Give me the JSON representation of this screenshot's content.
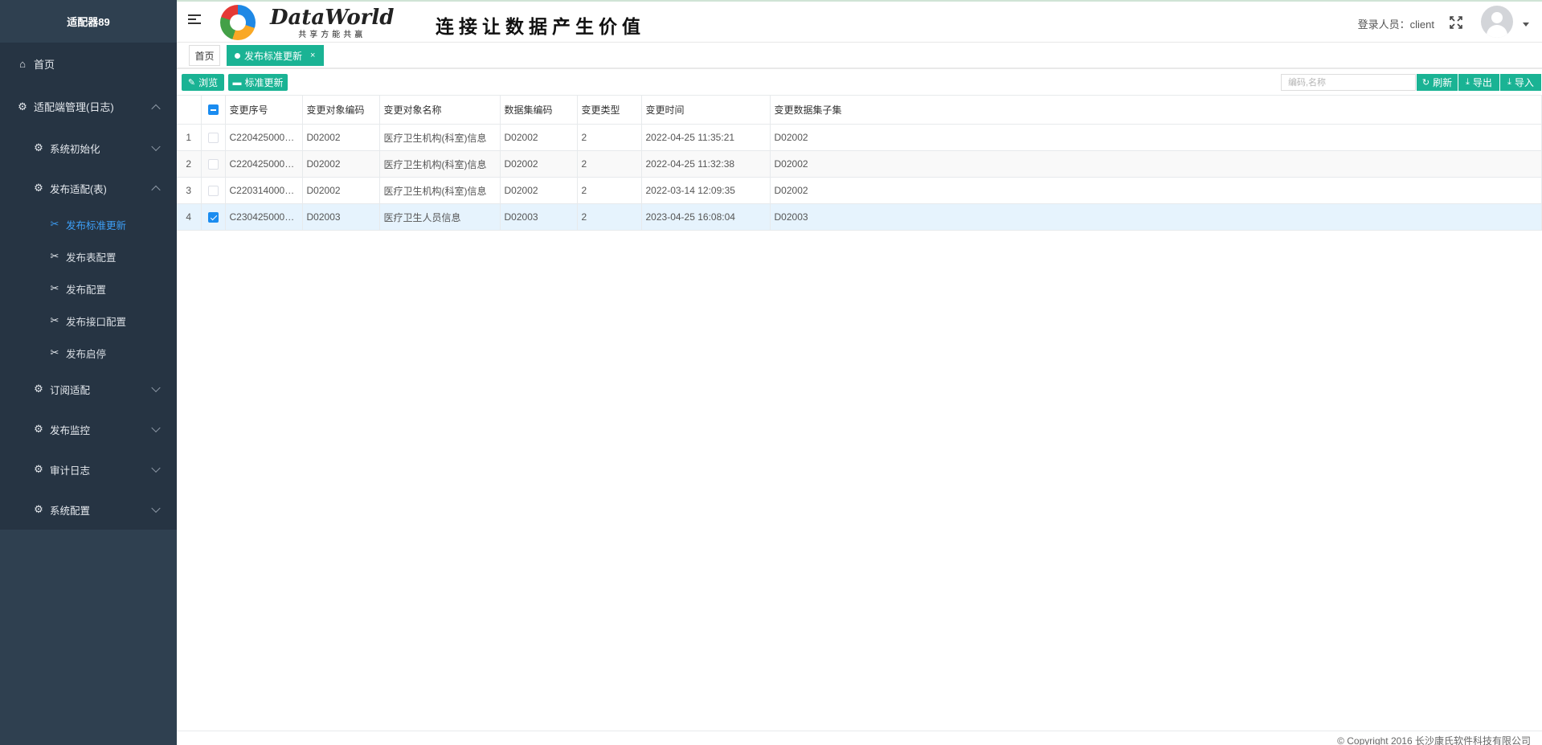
{
  "app": {
    "title": "适配器89"
  },
  "sidebar": {
    "home": "首页",
    "section": "适配端管理(日志)",
    "groups": [
      {
        "label": "系统初始化"
      },
      {
        "label": "发布适配(表)"
      },
      {
        "label": "订阅适配"
      },
      {
        "label": "发布监控"
      },
      {
        "label": "审计日志"
      },
      {
        "label": "系统配置"
      }
    ],
    "sub_items": [
      {
        "label": "发布标准更新"
      },
      {
        "label": "发布表配置"
      },
      {
        "label": "发布配置"
      },
      {
        "label": "发布接口配置"
      },
      {
        "label": "发布启停"
      }
    ]
  },
  "header": {
    "logo_name": "DataWorld",
    "logo_sub": "共享方能共赢",
    "slogan": "连接让数据产生价值",
    "user_label": "登录人员：client"
  },
  "tabs": {
    "home": "首页",
    "active": "发布标准更新",
    "close": "×"
  },
  "toolbar": {
    "browse": "浏览",
    "standard_update": "标准更新",
    "search_placeholder": "编码,名称",
    "refresh": "刷新",
    "export": "导出",
    "import": "导入"
  },
  "table": {
    "columns": [
      "变更序号",
      "变更对象编码",
      "变更对象名称",
      "数据集编码",
      "变更类型",
      "变更时间",
      "变更数据集子集"
    ],
    "rows": [
      {
        "index": "1",
        "seq": "C220425000…",
        "obj_code": "D02002",
        "obj_name": "医疗卫生机构(科室)信息",
        "dataset_code": "D02002",
        "type": "2",
        "time": "2022-04-25 11:35:21",
        "subset": "D02002"
      },
      {
        "index": "2",
        "seq": "C220425000…",
        "obj_code": "D02002",
        "obj_name": "医疗卫生机构(科室)信息",
        "dataset_code": "D02002",
        "type": "2",
        "time": "2022-04-25 11:32:38",
        "subset": "D02002"
      },
      {
        "index": "3",
        "seq": "C220314000…",
        "obj_code": "D02002",
        "obj_name": "医疗卫生机构(科室)信息",
        "dataset_code": "D02002",
        "type": "2",
        "time": "2022-03-14 12:09:35",
        "subset": "D02002"
      },
      {
        "index": "4",
        "seq": "C230425000…",
        "obj_code": "D02003",
        "obj_name": "医疗卫生人员信息",
        "dataset_code": "D02003",
        "type": "2",
        "time": "2023-04-25 16:08:04",
        "subset": "D02003"
      }
    ]
  },
  "footer": {
    "copyright": "© Copyright 2016 长沙康氏软件科技有限公司"
  },
  "colors": {
    "sidebar_bg": "#2f4050",
    "accent": "#1ab394",
    "active_link": "#3d9ef5",
    "checkbox": "#1a8cf0"
  }
}
